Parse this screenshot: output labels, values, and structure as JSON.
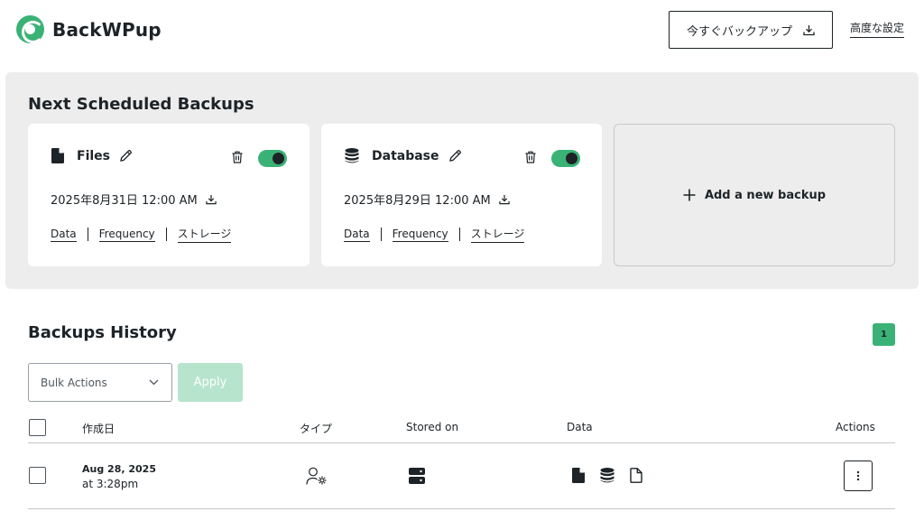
{
  "header": {
    "logo_text": "BackWPup",
    "backup_now_label": "今すぐバックアップ",
    "advanced_settings_label": "高度な設定"
  },
  "scheduled": {
    "title": "Next Scheduled Backups",
    "cards": [
      {
        "name": "Files",
        "icon": "file-icon",
        "date": "2025年8月31日 12:00 AM",
        "enabled": true,
        "links": [
          "Data",
          "Frequency",
          "ストレージ"
        ]
      },
      {
        "name": "Database",
        "icon": "database-icon",
        "date": "2025年8月29日 12:00 AM",
        "enabled": true,
        "links": [
          "Data",
          "Frequency",
          "ストレージ"
        ]
      }
    ],
    "add_label": "Add a new backup"
  },
  "history": {
    "title": "Backups History",
    "page": "1",
    "bulk_actions_label": "Bulk Actions",
    "apply_label": "Apply",
    "columns": [
      "作成日",
      "タイプ",
      "Stored on",
      "Data",
      "Actions"
    ],
    "rows": [
      {
        "date": "Aug 28, 2025",
        "time": "at 3:28pm",
        "type_icon": "user-gear-icon",
        "stored_icon": "server-icon",
        "data_icons": [
          "file-icon",
          "database-icon",
          "file-outline-icon"
        ]
      }
    ]
  },
  "colors": {
    "accent": "#3ab276",
    "accent_light": "#b7e4cc",
    "panel_bg": "#ededed",
    "text": "#1d2327"
  }
}
